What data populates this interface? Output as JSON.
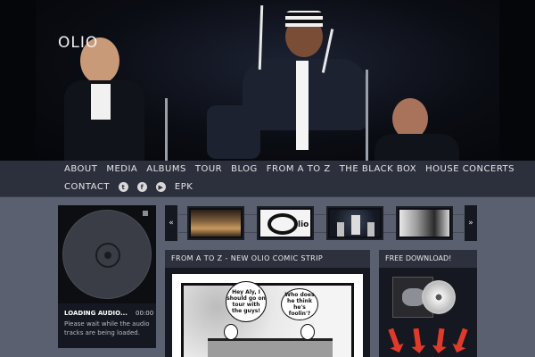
{
  "site": {
    "logo": "OLIO"
  },
  "nav": {
    "row1": [
      "ABOUT",
      "MEDIA",
      "ALBUMS",
      "TOUR",
      "BLOG",
      "FROM A TO Z",
      "THE BLACK BOX",
      "HOUSE CONCERTS"
    ],
    "contact": "CONTACT",
    "epk": "EPK",
    "social_icons": [
      "twitter-icon",
      "facebook-icon",
      "youtube-icon"
    ]
  },
  "player": {
    "title": "LOADING AUDIO...",
    "time": "00:00",
    "message": "Please wait while the audio tracks are being loaded."
  },
  "carousel": {
    "prev_icon": "double-chevron-left-icon",
    "next_icon": "chevron-right-icon",
    "prev_glyph": "«",
    "next_glyph": "»",
    "thumbs": [
      "studio-photo",
      "olio-logo",
      "band-stage-photo",
      "band-group-photo"
    ]
  },
  "comic_panel": {
    "title": "FROM A TO Z - NEW OLIO COMIC STRIP",
    "bubble1": "Hey Aly, I should go on tour with the guys!",
    "bubble2": "Who does he think he's foolin'?"
  },
  "download": {
    "title": "FREE DOWNLOAD!"
  },
  "colors": {
    "background": "#5a6070",
    "panel": "#151820",
    "accent_red": "#e03a2a"
  }
}
